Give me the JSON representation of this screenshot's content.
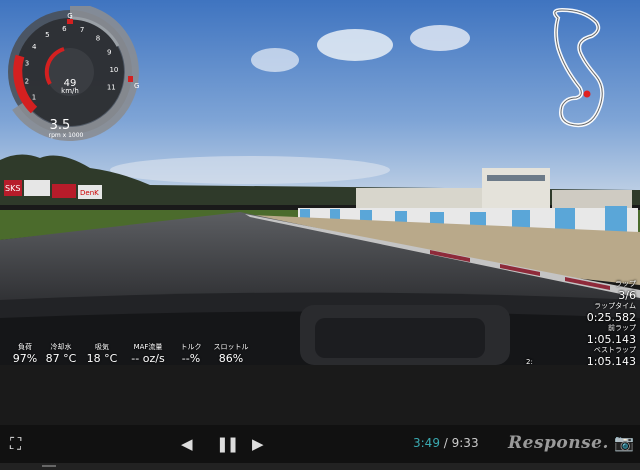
{
  "gauge": {
    "speed": "49",
    "speed_unit": "km/h",
    "rpm": "3.5",
    "rpm_unit": "rpm x 1000",
    "g_top": "G",
    "g_right": "G",
    "ticks": [
      "1",
      "2",
      "3",
      "4",
      "5",
      "6",
      "7",
      "8",
      "9",
      "10",
      "11"
    ]
  },
  "billboards": [
    "SKS",
    "DenK"
  ],
  "stats": [
    {
      "label": "負荷",
      "value": "97%"
    },
    {
      "label": "冷却水",
      "value": "87 °C"
    },
    {
      "label": "吸気",
      "value": "18 °C"
    },
    {
      "label": "MAF流量",
      "value": "-- oz/s"
    },
    {
      "label": "トルク",
      "value": "--%"
    },
    {
      "label": "スロットル",
      "value": "86%"
    }
  ],
  "lap": {
    "lap_label": "ラップ",
    "lap_count": "3/6",
    "lap_time_label": "ラップタイム",
    "lap_time": "0:25.582",
    "prev_lap_label": "前ラップ",
    "prev_lap": "1:05.143",
    "best_lap_label": "ベストラップ",
    "best_lap_num": "2:",
    "best_lap": "1:05.143"
  },
  "controls": {
    "fullscreen_icon": "⛶",
    "prev_icon": "◀",
    "pause_icon": "❚❚",
    "next_icon": "▶",
    "current_time": "3:49",
    "separator": " / ",
    "total_time": "9:33",
    "logo": "Response.",
    "camera_icon": "📷"
  },
  "colors": {
    "accent": "#3aa9b0",
    "gauge_red": "#d42020",
    "sky": "#4a7fc4"
  }
}
